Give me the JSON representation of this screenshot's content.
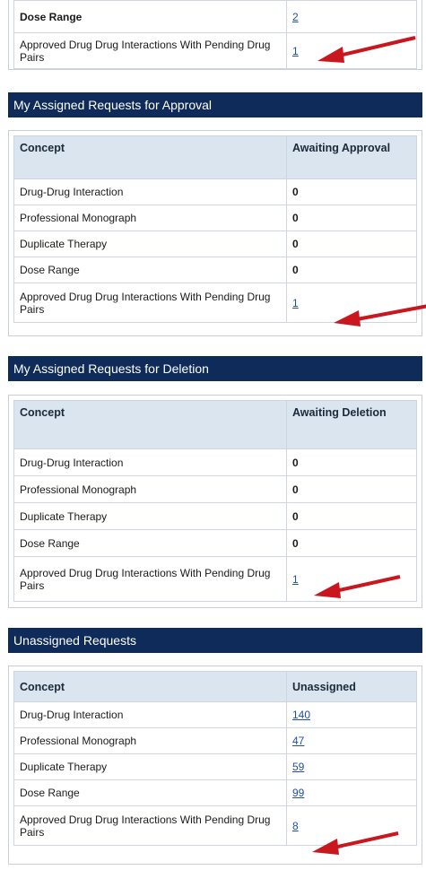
{
  "top_section": {
    "rows": [
      {
        "concept": "Dose Range",
        "value": "2"
      },
      {
        "concept": "Approved Drug Drug Interactions With Pending Drug Pairs",
        "value": "1"
      }
    ]
  },
  "sections": [
    {
      "title": "My Assigned Requests for Approval",
      "col1": "Concept",
      "col2": "Awaiting Approval",
      "rows": [
        {
          "concept": "Drug-Drug Interaction",
          "value": "0"
        },
        {
          "concept": "Professional Monograph",
          "value": "0"
        },
        {
          "concept": "Duplicate Therapy",
          "value": "0"
        },
        {
          "concept": "Dose Range",
          "value": "0"
        },
        {
          "concept": "Approved Drug Drug Interactions With Pending Drug Pairs",
          "value": "1"
        }
      ]
    },
    {
      "title": "My Assigned Requests for Deletion",
      "col1": "Concept",
      "col2": "Awaiting Deletion",
      "rows": [
        {
          "concept": "Drug-Drug Interaction",
          "value": "0"
        },
        {
          "concept": "Professional Monograph",
          "value": "0"
        },
        {
          "concept": "Duplicate Therapy",
          "value": "0"
        },
        {
          "concept": "Dose Range",
          "value": "0"
        },
        {
          "concept": "Approved Drug Drug Interactions With Pending Drug Pairs",
          "value": "1"
        }
      ]
    },
    {
      "title": "Unassigned Requests",
      "col1": "Concept",
      "col2": "Unassigned",
      "rows": [
        {
          "concept": "Drug-Drug Interaction",
          "value": "140"
        },
        {
          "concept": "Professional Monograph",
          "value": "47"
        },
        {
          "concept": "Duplicate Therapy",
          "value": "59"
        },
        {
          "concept": "Dose Range",
          "value": "99"
        },
        {
          "concept": "Approved Drug Drug Interactions With Pending Drug Pairs",
          "value": "8"
        }
      ]
    }
  ],
  "colors": {
    "header_bg": "#0e2b59",
    "table_header_bg": "#dbe5ef",
    "link": "#1f4fa8",
    "arrow": "#c8171e"
  },
  "icons": {
    "annotation": "red-arrow-icon"
  }
}
